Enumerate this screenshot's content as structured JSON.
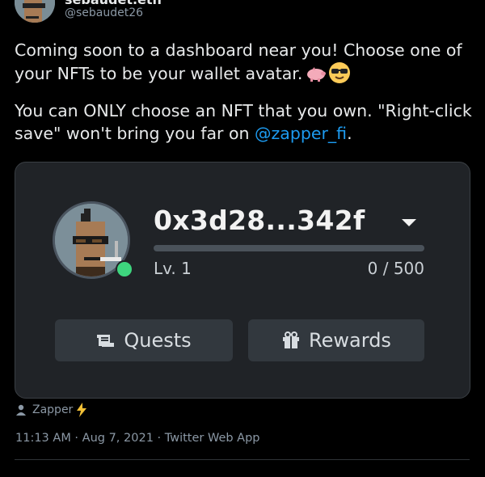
{
  "author": {
    "display_name": "sebaudet.eth",
    "handle": "@sebaudet26"
  },
  "tweet": {
    "line1_a": "Coming soon to a dashboard near you! Choose one of your NFTs to be your wallet avatar.",
    "line2_a": "You can ONLY choose an NFT that you own. \"Right-click save\" won't bring you far on ",
    "mention": "@zapper_fi",
    "line2_b": "."
  },
  "card": {
    "address": "0x3d28...342f",
    "level": "Lv. 1",
    "xp": "0 / 500",
    "progress_fraction": 0.0,
    "quests_label": "Quests",
    "rewards_label": "Rewards",
    "status_color": "#3ed57e"
  },
  "footer": {
    "via": "Zapper",
    "meta": "11:13 AM · Aug 7, 2021 · Twitter Web App"
  }
}
